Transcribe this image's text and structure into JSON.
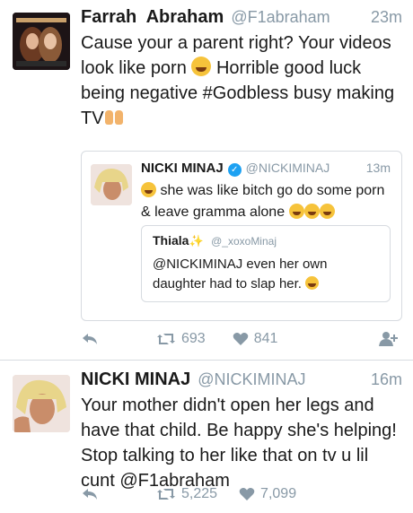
{
  "tweet1": {
    "name": "Farrah  Abraham",
    "handle": "@F1abraham",
    "time": "23m",
    "text_part1": "Cause your a parent right? Your videos look like porn ",
    "text_part2": " Horrible good luck being negative #Godbless busy making TV",
    "quote": {
      "name": "NICKI MINAJ",
      "handle": "@NICKIMINAJ",
      "time": "13m",
      "text_part1": " she was like bitch go do some porn & leave gramma alone ",
      "inner": {
        "name": "Thiala",
        "sparkle": "✨",
        "handle": "@_xoxoMinaj",
        "text": "@NICKIMINAJ even her own daughter had to slap her. "
      }
    },
    "retweets": "693",
    "likes": "841"
  },
  "tweet2": {
    "name": "NICKI MINAJ",
    "handle": "@NICKIMINAJ",
    "time": "16m",
    "text": "Your mother didn't open her legs and have that child. Be happy she's helping! Stop talking to her like that on tv u lil cunt @F1abraham",
    "retweets": "5,225",
    "likes": "7,099"
  },
  "icons": {
    "reply": "reply-icon",
    "retweet": "retweet-icon",
    "like": "heart-icon",
    "follow": "follow-icon",
    "verified": "verified-badge-icon",
    "emoji_laugh": "face-with-tears-of-joy-icon",
    "emoji_hands": "raised-hands-icon"
  },
  "colors": {
    "handle_gray": "#8899a6",
    "verified_blue": "#1da1f2",
    "border": "#d7dbe0"
  }
}
